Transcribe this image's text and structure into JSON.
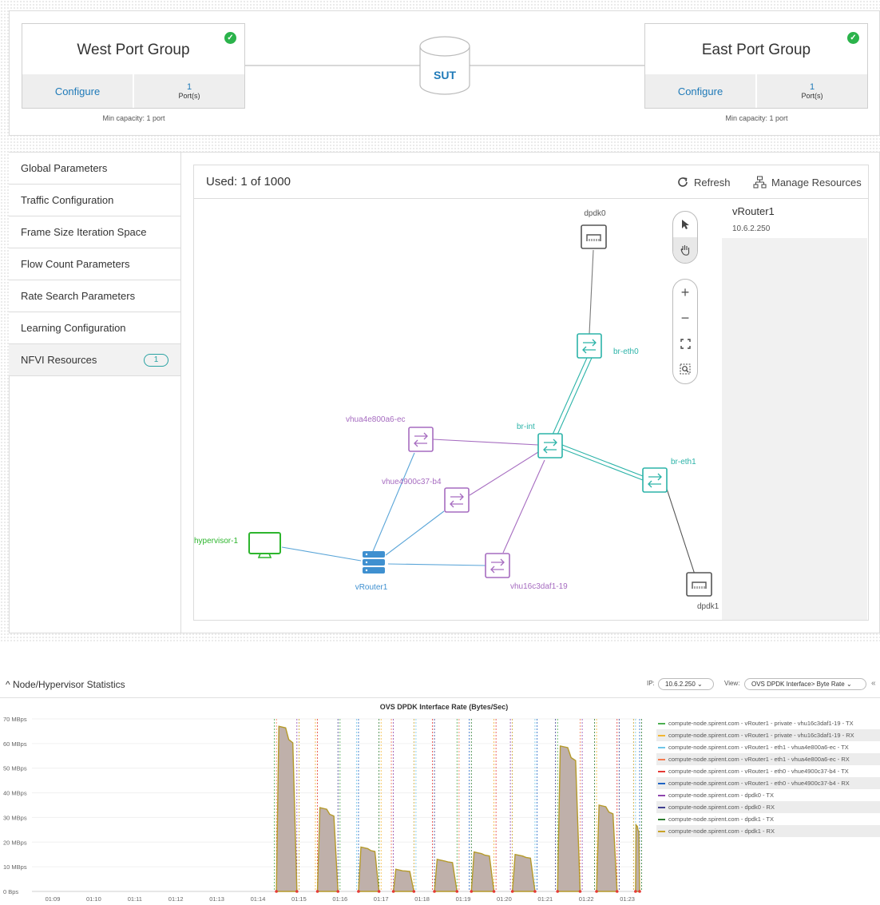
{
  "west": {
    "title": "West Port Group",
    "configure": "Configure",
    "ports": "1",
    "ports_label": "Port(s)",
    "min_capacity": "Min capacity: 1 port"
  },
  "east": {
    "title": "East Port Group",
    "configure": "Configure",
    "ports": "1",
    "ports_label": "Port(s)",
    "min_capacity": "Min capacity: 1 port"
  },
  "sut": {
    "label": "SUT"
  },
  "sidebar": {
    "items": [
      {
        "label": "Global Parameters"
      },
      {
        "label": "Traffic Configuration"
      },
      {
        "label": "Frame Size Iteration Space"
      },
      {
        "label": "Flow Count Parameters"
      },
      {
        "label": "Rate Search Parameters"
      },
      {
        "label": "Learning Configuration"
      },
      {
        "label": "NFVI Resources",
        "badge": "1"
      }
    ]
  },
  "topology": {
    "used": "Used: 1 of 1000",
    "refresh": "Refresh",
    "manage": "Manage Resources",
    "selected": {
      "name": "vRouter1",
      "ip": "10.6.2.250"
    },
    "nodes": {
      "dpdk0": "dpdk0",
      "br_eth0": "br-eth0",
      "br_int": "br-int",
      "br_eth1": "br-eth1",
      "vhua4e800a6_ec": "vhua4e800a6-ec",
      "vhue4900c37_b4": "vhue4900c37-b4",
      "hypervisor": "hypervisor-1",
      "vrouter": "vRouter1",
      "vhu16c3daf1_19": "vhu16c3daf1-19",
      "dpdk1": "dpdk1"
    }
  },
  "stats": {
    "title": "Node/Hypervisor Statistics",
    "ip_label": "IP:",
    "ip_value": "10.6.2.250",
    "view_label": "View:",
    "view_value": "OVS DPDK Interface> Byte Rate"
  },
  "chart_data": {
    "type": "area",
    "title": "OVS DPDK Interface Rate (Bytes/Sec)",
    "y_ticks": [
      "0 Bps",
      "10 MBps",
      "20 MBps",
      "30 MBps",
      "40 MBps",
      "50 MBps",
      "60 MBps",
      "70 MBps"
    ],
    "ylim": [
      0,
      70
    ],
    "x_ticks": [
      "01:09",
      "01:10",
      "01:11",
      "01:12",
      "01:13",
      "01:14",
      "01:15",
      "01:16",
      "01:17",
      "01:18",
      "01:19",
      "01:20",
      "01:21",
      "01:22",
      "01:23"
    ],
    "peaks": [
      {
        "start": 14.45,
        "end": 14.95,
        "value": 67
      },
      {
        "start": 15.45,
        "end": 15.95,
        "value": 34
      },
      {
        "start": 16.45,
        "end": 16.95,
        "value": 18
      },
      {
        "start": 17.3,
        "end": 17.8,
        "value": 9
      },
      {
        "start": 18.3,
        "end": 18.85,
        "value": 13
      },
      {
        "start": 19.2,
        "end": 19.75,
        "value": 16
      },
      {
        "start": 20.2,
        "end": 20.75,
        "value": 15
      },
      {
        "start": 21.3,
        "end": 21.85,
        "value": 59
      },
      {
        "start": 22.25,
        "end": 22.75,
        "value": 35
      },
      {
        "start": 23.2,
        "end": 23.3,
        "value": 27
      }
    ],
    "series": [
      {
        "name": "compute-node.spirent.com - vRouter1 - private - vhu16c3daf1-19 - TX",
        "color": "#4caf50"
      },
      {
        "name": "compute-node.spirent.com - vRouter1 - private - vhu16c3daf1-19 - RX",
        "color": "#f2b632"
      },
      {
        "name": "compute-node.spirent.com - vRouter1 - eth1 - vhua4e800a6-ec - TX",
        "color": "#6ec6e8"
      },
      {
        "name": "compute-node.spirent.com - vRouter1 - eth1 - vhua4e800a6-ec - RX",
        "color": "#f47b50"
      },
      {
        "name": "compute-node.spirent.com - vRouter1 - eth0 - vhue4900c37-b4 - TX",
        "color": "#e53935"
      },
      {
        "name": "compute-node.spirent.com - vRouter1 - eth0 - vhue4900c37-b4 - RX",
        "color": "#1e63c4"
      },
      {
        "name": "compute-node.spirent.com - dpdk0 - TX",
        "color": "#8e44ad"
      },
      {
        "name": "compute-node.spirent.com - dpdk0 - RX",
        "color": "#3f3f8f"
      },
      {
        "name": "compute-node.spirent.com - dpdk1 - TX",
        "color": "#2e7d32"
      },
      {
        "name": "compute-node.spirent.com - dpdk1 - RX",
        "color": "#c9a227"
      }
    ]
  }
}
